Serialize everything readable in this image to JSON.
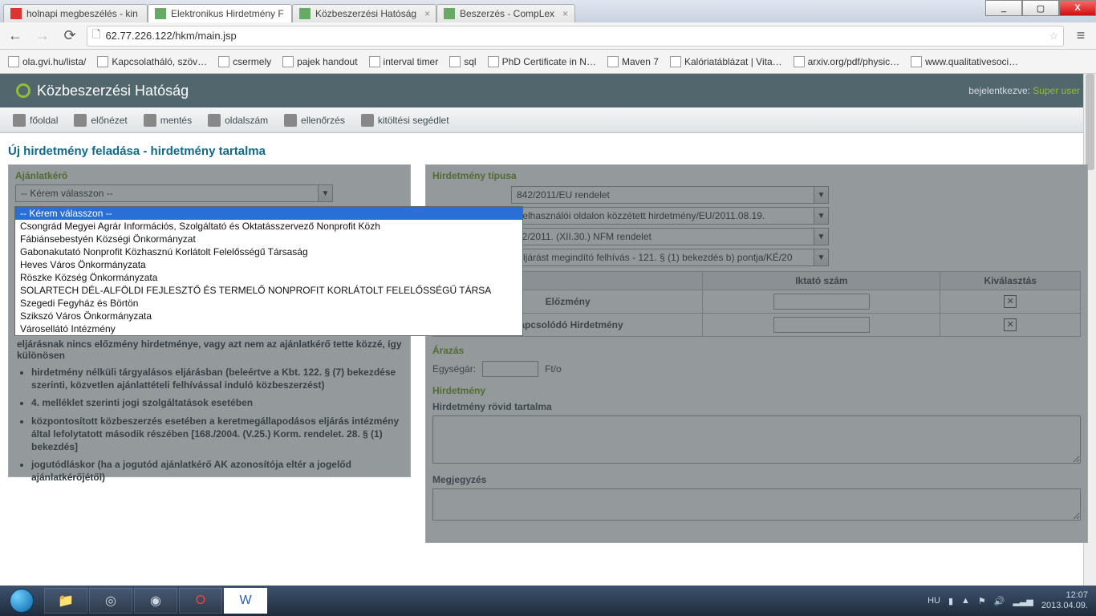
{
  "window": {
    "min": "_",
    "max": "▢",
    "close": "X"
  },
  "browser_tabs": [
    {
      "label": "holnapi megbeszélés - kin",
      "icon": "gmail"
    },
    {
      "label": "Elektronikus Hirdetmény F",
      "icon": "doc",
      "active": true
    },
    {
      "label": "Közbeszerzési Hatóság",
      "icon": "kbh"
    },
    {
      "label": "Beszerzés - CompLex",
      "icon": "cl"
    }
  ],
  "address_bar": {
    "url": "62.77.226.122/hkm/main.jsp"
  },
  "bookmarks": [
    "ola.gvi.hu/lista/",
    "Kapcsolatháló, szöv…",
    "csermely",
    "pajek handout",
    "interval timer",
    "sql",
    "PhD Certificate in N…",
    "Maven 7",
    "Kalóriatáblázat | Vita…",
    "arxiv.org/pdf/physic…",
    "www.qualitativesoci…"
  ],
  "site_header": {
    "title": "Közbeszerzési Hatóság",
    "login_label": "bejelentkezve:",
    "user": "Super user"
  },
  "toolbar": [
    {
      "id": "home",
      "label": "főoldal"
    },
    {
      "id": "preview",
      "label": "előnézet"
    },
    {
      "id": "save",
      "label": "mentés"
    },
    {
      "id": "pagenum",
      "label": "oldalszám"
    },
    {
      "id": "check",
      "label": "ellenőrzés"
    },
    {
      "id": "help",
      "label": "kitöltési segédlet"
    }
  ],
  "page_heading": "Új hirdetmény feladása - hirdetmény tartalma",
  "left": {
    "title": "Ajánlatkérő",
    "combo_value": "-- Kérem válasszon --",
    "options": [
      "-- Kérem válasszon --",
      "Csongrád Megyei Agrár Információs, Szolgáltató és Oktatásszervező Nonprofit Közh",
      "Fábiánsebestyén Községi Önkormányzat",
      "Gabonakutató Nonprofit Közhasznú Korlátolt Felelősségű Társaság",
      "Heves Város Önkormányzata",
      "Röszke Község Önkormányzata",
      "SOLARTECH DÉL-ALFÖLDI FEJLESZTŐ ÉS TERMELŐ NONPROFIT KORLÁTOLT FELELŐSSÉGŰ TÁRSA",
      "Szegedi Fegyház és Börtön",
      "Szikszó Város Önkormányzata",
      "Városellátó Intézmény"
    ],
    "note_line": "eljárásnak nincs előzmény hirdetménye, vagy azt nem az ajánlatkérő tette közzé, így különösen",
    "bullets": [
      "hirdetmény nélküli tárgyalásos eljárásban (beleértve a Kbt. 122. § (7) bekezdése szerinti, közvetlen ajánlattételi felhívással induló közbeszerzést)",
      "4. melléklet szerinti jogi szolgáltatások esetében",
      "központosított közbeszerzés esetében a keretmegállapodásos eljárás intézmény által lefolytatott második részében [168./2004. (V.25.) Korm. rendelet. 28. § (1) bekezdés]",
      "jogutódláskor (ha a jogutód ajánlatkérő AK azonosítója eltér a jogelőd ajánlatkérőjétől)"
    ]
  },
  "right": {
    "sec1_title": "Hirdetmény típusa",
    "sel_values": [
      "842/2011/EU rendelet",
      "Felhasználói oldalon közzétett hirdetmény/EU/2011.08.19.",
      "92/2011. (XII.30.) NFM rendelet",
      "Eljárást megindító felhívás - 121. § (1) bekezdés b) pontja/KÉ/20"
    ],
    "table_headers": [
      "",
      "Iktató szám",
      "Kiválasztás"
    ],
    "row_labels": [
      "Előzmény",
      "Kapcsolódó Hirdetmény"
    ],
    "sec2_title": "Árazás",
    "price_label": "Egységár:",
    "price_unit": "Ft/o",
    "sec3_title": "Hirdetmény",
    "content_label": "Hirdetmény rövid tartalma",
    "note_label": "Megjegyzés"
  },
  "taskbar": {
    "lang": "HU",
    "time": "12:07",
    "date": "2013.04.09."
  }
}
